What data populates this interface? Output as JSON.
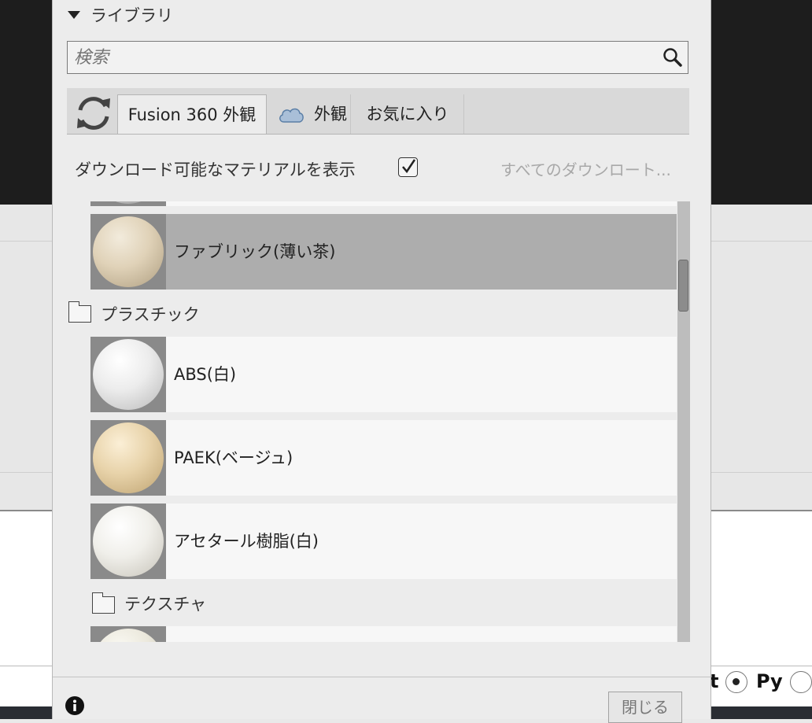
{
  "library": {
    "title": "ライブラリ"
  },
  "search": {
    "placeholder": "検索"
  },
  "tabs": [
    {
      "label": "Fusion 360 外観"
    },
    {
      "label": "外観"
    },
    {
      "label": "お気に入り"
    }
  ],
  "options": {
    "show_downloadable": "ダウンロード可能なマテリアルを表示",
    "download_all": "すべてのダウンロート..."
  },
  "materials": {
    "fabric_light_brown": "ファブリック(薄い茶)",
    "plastic_folder": "プラスチック",
    "abs_white": "ABS(白)",
    "paek_beige": "PAEK(ベージュ)",
    "acetal_white": "アセタール樹脂(白)",
    "texture_folder": "テクスチャ"
  },
  "footer": {
    "close_label": "閉じる"
  },
  "background": {
    "radio_t": "t",
    "radio_py": "Py"
  }
}
